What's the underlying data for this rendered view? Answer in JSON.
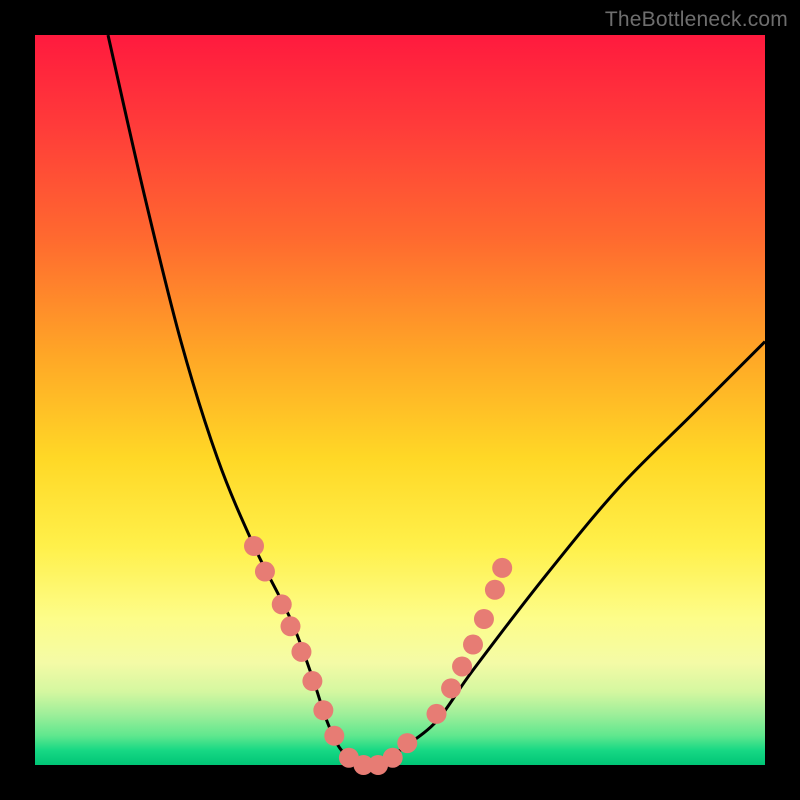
{
  "watermark": "TheBottleneck.com",
  "chart_data": {
    "type": "line",
    "title": "",
    "xlabel": "",
    "ylabel": "",
    "xlim": [
      0,
      100
    ],
    "ylim": [
      0,
      100
    ],
    "grid": false,
    "series": [
      {
        "name": "bottleneck-curve",
        "x": [
          10,
          15,
          20,
          25,
          30,
          35,
          38,
          40,
          42,
          45,
          48,
          50,
          55,
          60,
          70,
          80,
          90,
          100
        ],
        "y": [
          100,
          78,
          58,
          42,
          30,
          20,
          12,
          6,
          2,
          0,
          0,
          2,
          6,
          13,
          26,
          38,
          48,
          58
        ],
        "color": "#000000"
      }
    ],
    "markers": {
      "name": "highlight-dots",
      "color": "#e77c74",
      "radius": 10,
      "points": [
        {
          "x": 30.0,
          "y": 30.0
        },
        {
          "x": 31.5,
          "y": 26.5
        },
        {
          "x": 33.8,
          "y": 22.0
        },
        {
          "x": 35.0,
          "y": 19.0
        },
        {
          "x": 36.5,
          "y": 15.5
        },
        {
          "x": 38.0,
          "y": 11.5
        },
        {
          "x": 39.5,
          "y": 7.5
        },
        {
          "x": 41.0,
          "y": 4.0
        },
        {
          "x": 43.0,
          "y": 1.0
        },
        {
          "x": 45.0,
          "y": 0.0
        },
        {
          "x": 47.0,
          "y": 0.0
        },
        {
          "x": 49.0,
          "y": 1.0
        },
        {
          "x": 51.0,
          "y": 3.0
        },
        {
          "x": 55.0,
          "y": 7.0
        },
        {
          "x": 57.0,
          "y": 10.5
        },
        {
          "x": 58.5,
          "y": 13.5
        },
        {
          "x": 60.0,
          "y": 16.5
        },
        {
          "x": 61.5,
          "y": 20.0
        },
        {
          "x": 63.0,
          "y": 24.0
        },
        {
          "x": 64.0,
          "y": 27.0
        }
      ]
    }
  }
}
